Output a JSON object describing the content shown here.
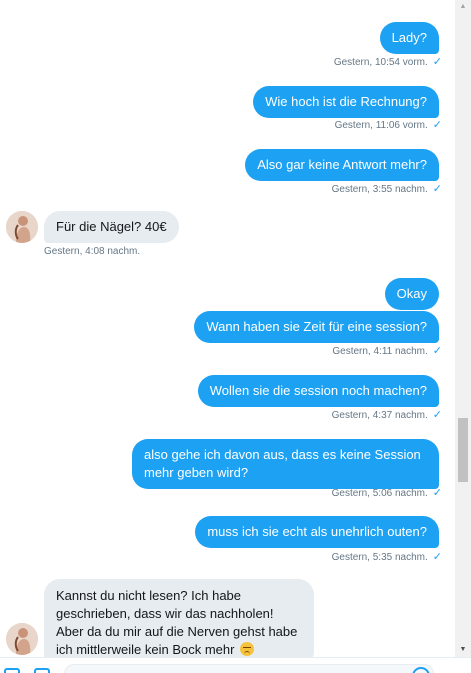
{
  "conversation": {
    "messages": [
      {
        "side": "sent",
        "text": "Lady?",
        "time": "Gestern, 10:54 vorm.",
        "read": "✓"
      },
      {
        "side": "sent",
        "text": "Wie hoch ist die Rechnung?",
        "time": "Gestern, 11:06 vorm.",
        "read": "✓"
      },
      {
        "side": "sent",
        "text": "Also gar keine Antwort mehr?",
        "time": "Gestern, 3:55 nachm.",
        "read": "✓"
      },
      {
        "side": "received",
        "text": "Für die Nägel? 40€",
        "time": "Gestern, 4:08 nachm."
      },
      {
        "side": "sent",
        "text": "Okay"
      },
      {
        "side": "sent",
        "text": "Wann haben sie Zeit für eine session?",
        "time": "Gestern, 4:11 nachm.",
        "read": "✓"
      },
      {
        "side": "sent",
        "text": "Wollen sie die session noch machen?",
        "time": "Gestern, 4:37 nachm.",
        "read": "✓"
      },
      {
        "side": "sent",
        "text": "also gehe ich davon aus, dass es keine Session mehr geben wird?",
        "time": "Gestern, 5:06 nachm.",
        "read": "✓"
      },
      {
        "side": "sent",
        "text": "muss ich sie echt als unehrlich outen?",
        "time": "Gestern, 5:35 nachm.",
        "read": "✓"
      },
      {
        "side": "received",
        "text": "Kannst du nicht lesen? Ich habe geschrieben, dass wir das nachholen! Aber da du mir auf die Nerven gehst habe ich mittlerweile kein Bock mehr",
        "emoji": "angry-face"
      }
    ]
  },
  "scrollbar": {
    "up_arrow": "▲",
    "down_arrow": "▼"
  },
  "colors": {
    "sent_bubble": "#1da1f2",
    "received_bubble": "#e6ecf0",
    "timestamp": "#657786",
    "read_check": "#1da1f2"
  },
  "icons": {
    "avatar": "contact-avatar",
    "composer_left": [
      "media-icon",
      "gif-icon"
    ],
    "composer_right": "emoji-icon"
  }
}
